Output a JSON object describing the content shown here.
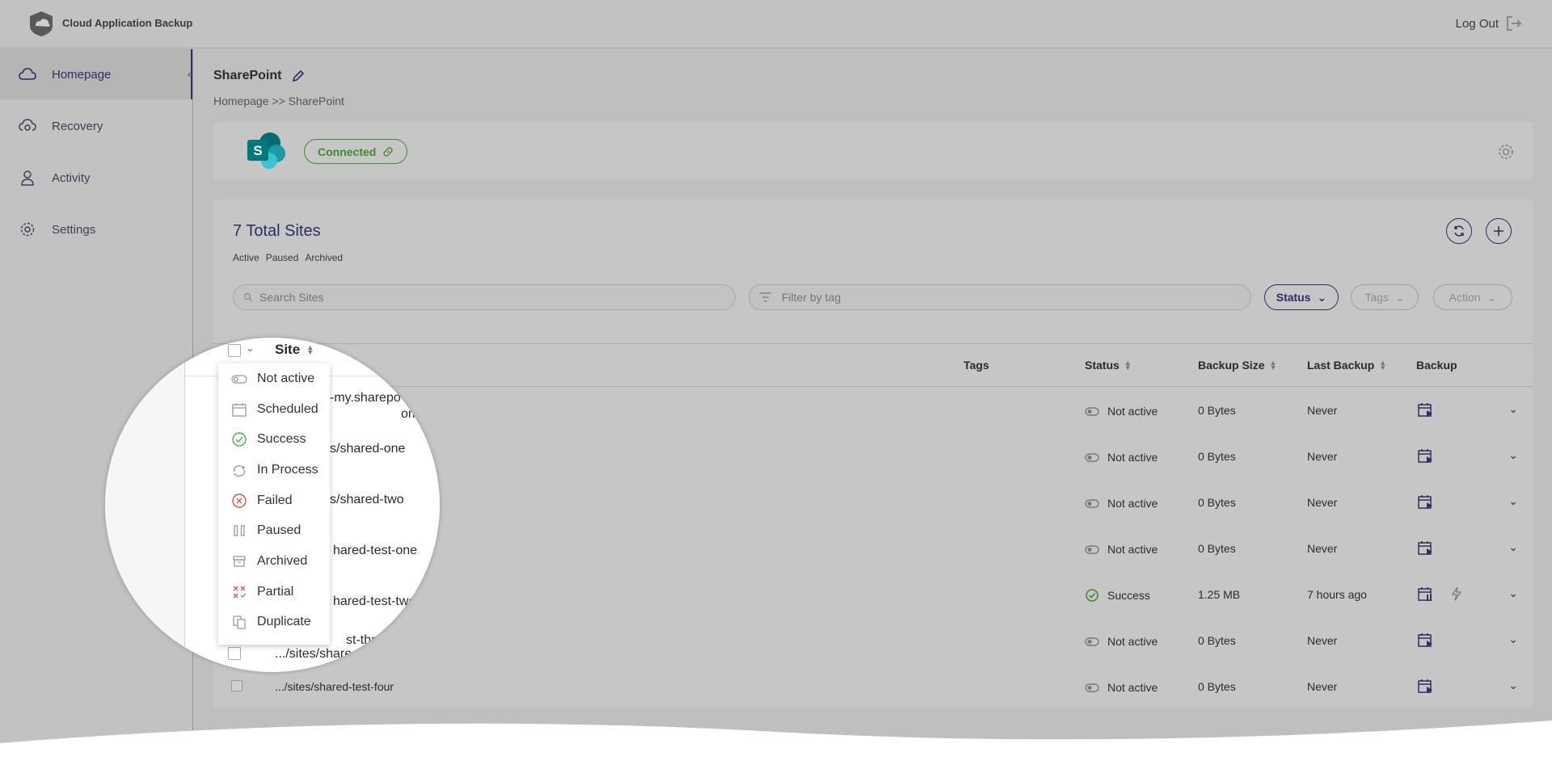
{
  "app": {
    "title": "Cloud Application Backup",
    "logout_label": "Log Out"
  },
  "sidebar": {
    "items": [
      {
        "label": "Homepage",
        "icon": "cloud-icon"
      },
      {
        "label": "Recovery",
        "icon": "cloud-restore-icon"
      },
      {
        "label": "Activity",
        "icon": "user-icon"
      },
      {
        "label": "Settings",
        "icon": "gear-icon"
      }
    ]
  },
  "header": {
    "title": "SharePoint",
    "breadcrumb": "Homepage >> SharePoint"
  },
  "connection": {
    "status_label": "Connected"
  },
  "sites": {
    "title": "7 Total Sites",
    "filters": [
      "Active",
      "Paused",
      "Archived"
    ],
    "search_placeholder": "Search Sites",
    "tag_placeholder": "Filter by tag",
    "status_button": "Status",
    "tags_button": "Tags",
    "action_button": "Action",
    "columns": {
      "site": "Site",
      "tags": "Tags",
      "status": "Status",
      "backup_size": "Backup Size",
      "last_backup": "Last Backup",
      "backup": "Backup"
    },
    "rows": [
      {
        "site": "-my.sharepoint.com",
        "status": "Not active",
        "size": "0 Bytes",
        "last": "Never"
      },
      {
        "site": "s/shared-one",
        "status": "Not active",
        "size": "0 Bytes",
        "last": "Never"
      },
      {
        "site": "s/shared-two",
        "status": "Not active",
        "size": "0 Bytes",
        "last": "Never"
      },
      {
        "site": "hared-test-one",
        "status": "Not active",
        "size": "0 Bytes",
        "last": "Never"
      },
      {
        "site": "hared-test-two",
        "status": "Success",
        "size": "1.25 MB",
        "last": "7 hours ago"
      },
      {
        "site": ".../sites/shared-test-three",
        "status": "Not active",
        "size": "0 Bytes",
        "last": "Never"
      },
      {
        "site": ".../sites/shared-test-four",
        "status": "Not active",
        "size": "0 Bytes",
        "last": "Never"
      }
    ]
  },
  "magnifier": {
    "site_header": "Site",
    "rows": [
      "-my.sharepo",
      "om",
      "s/shared-one",
      "s/shared-two",
      "hared-test-one",
      "hared-test-two",
      ".../sites/share",
      "st-three"
    ],
    "dropdown": [
      {
        "label": "Not active",
        "icon": "toggle-off-icon"
      },
      {
        "label": "Scheduled",
        "icon": "calendar-icon"
      },
      {
        "label": "Success",
        "icon": "check-circle-icon"
      },
      {
        "label": "In Process",
        "icon": "sync-icon"
      },
      {
        "label": "Failed",
        "icon": "x-circle-icon"
      },
      {
        "label": "Paused",
        "icon": "pause-icon"
      },
      {
        "label": "Archived",
        "icon": "archive-icon"
      },
      {
        "label": "Partial",
        "icon": "partial-icon"
      },
      {
        "label": "Duplicate",
        "icon": "duplicate-icon"
      }
    ]
  },
  "colors": {
    "accent": "#2c2f63",
    "connected": "#3f8a2c",
    "success": "#3f8a2c",
    "failed": "#d9534f"
  }
}
